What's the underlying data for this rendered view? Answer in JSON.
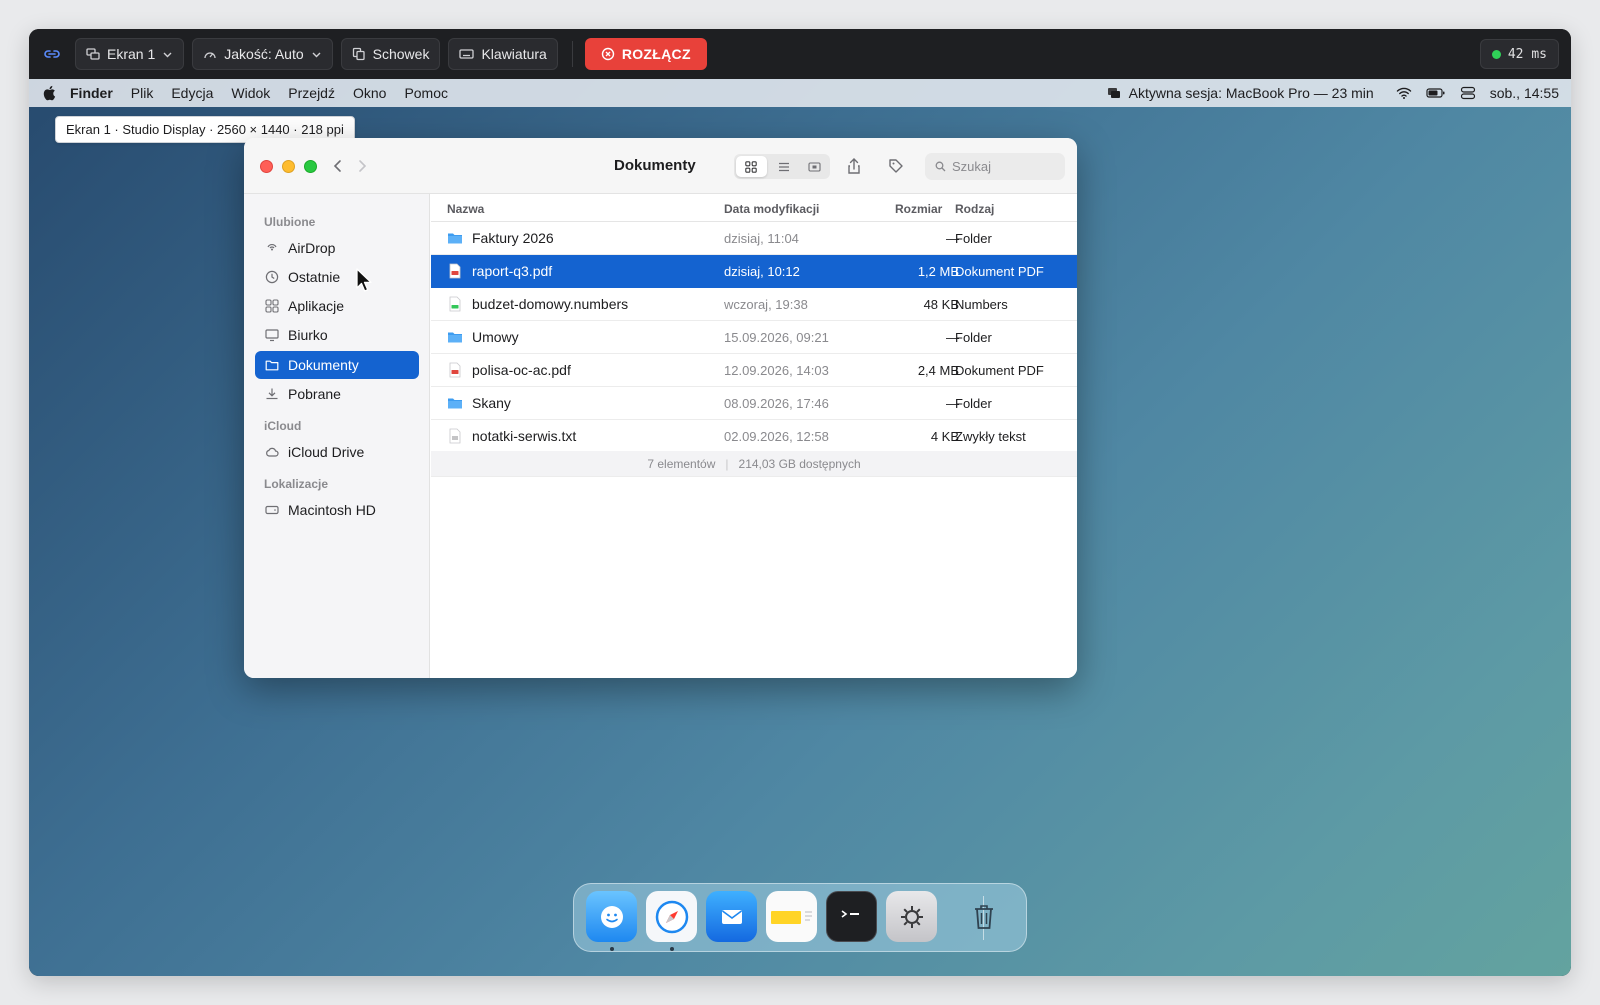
{
  "remote_toolbar": {
    "screen_label": "Ekran 1",
    "quality_label": "Jakość: Auto",
    "clipboard_label": "Schowek",
    "keyboard_label": "Klawiatura",
    "disconnect_label": "ROZŁĄCZ",
    "latency": "42 ms",
    "colors": {
      "disconnect": "#e8413a",
      "latency_ok": "#30d158"
    }
  },
  "tooltip": "Ekran 1 · Studio Display · 2560 × 1440 · 218 ppi",
  "menubar": {
    "app": "Finder",
    "items": [
      "Plik",
      "Edycja",
      "Widok",
      "Przejdź",
      "Okno",
      "Pomoc"
    ],
    "session": "Aktywna sesja: MacBook Pro — 23 min",
    "clock": "sob., 14:55"
  },
  "finder": {
    "title": "Dokumenty",
    "search_placeholder": "Szukaj",
    "sidebar": {
      "sections": [
        {
          "header": "Ulubione",
          "items": [
            {
              "label": "AirDrop",
              "icon": "airdrop-icon"
            },
            {
              "label": "Ostatnie",
              "icon": "clock-icon"
            },
            {
              "label": "Aplikacje",
              "icon": "apps-icon"
            },
            {
              "label": "Biurko",
              "icon": "desktop-icon"
            },
            {
              "label": "Dokumenty",
              "icon": "folder-icon",
              "selected": true
            },
            {
              "label": "Pobrane",
              "icon": "download-icon"
            }
          ]
        },
        {
          "header": "iCloud",
          "items": [
            {
              "label": "iCloud Drive",
              "icon": "cloud-icon"
            }
          ]
        },
        {
          "header": "Lokalizacje",
          "items": [
            {
              "label": "Macintosh HD",
              "icon": "disk-icon"
            }
          ]
        }
      ]
    },
    "columns": [
      "Nazwa",
      "Data modyfikacji",
      "Rozmiar",
      "Rodzaj"
    ],
    "files": [
      {
        "name": "Faktury 2026",
        "date": "dzisiaj, 11:04",
        "size": "—",
        "kind": "Folder",
        "icon": "folder-icon"
      },
      {
        "name": "raport-q3.pdf",
        "date": "dzisiaj, 10:12",
        "size": "1,2 MB",
        "kind": "Dokument PDF",
        "icon": "pdf-icon",
        "selected": true
      },
      {
        "name": "budzet-domowy.numbers",
        "date": "wczoraj, 19:38",
        "size": "48 KB",
        "kind": "Numbers",
        "icon": "numbers-icon"
      },
      {
        "name": "Umowy",
        "date": "15.09.2026, 09:21",
        "size": "—",
        "kind": "Folder",
        "icon": "folder-icon"
      },
      {
        "name": "polisa-oc-ac.pdf",
        "date": "12.09.2026, 14:03",
        "size": "2,4 MB",
        "kind": "Dokument PDF",
        "icon": "pdf-icon"
      },
      {
        "name": "Skany",
        "date": "08.09.2026, 17:46",
        "size": "—",
        "kind": "Folder",
        "icon": "folder-icon"
      },
      {
        "name": "notatki-serwis.txt",
        "date": "02.09.2026, 12:58",
        "size": "4 KB",
        "kind": "Zwykły tekst",
        "icon": "text-file-icon"
      }
    ],
    "status": {
      "count": "7 elementów",
      "free": "214,03 GB dostępnych"
    },
    "accent": "#1463d0"
  },
  "dock": {
    "apps": [
      "finder-icon",
      "safari-icon",
      "mail-icon",
      "notes-icon",
      "terminal-icon",
      "settings-icon",
      "trash-icon"
    ],
    "running": [
      "finder-icon",
      "safari-icon"
    ]
  }
}
